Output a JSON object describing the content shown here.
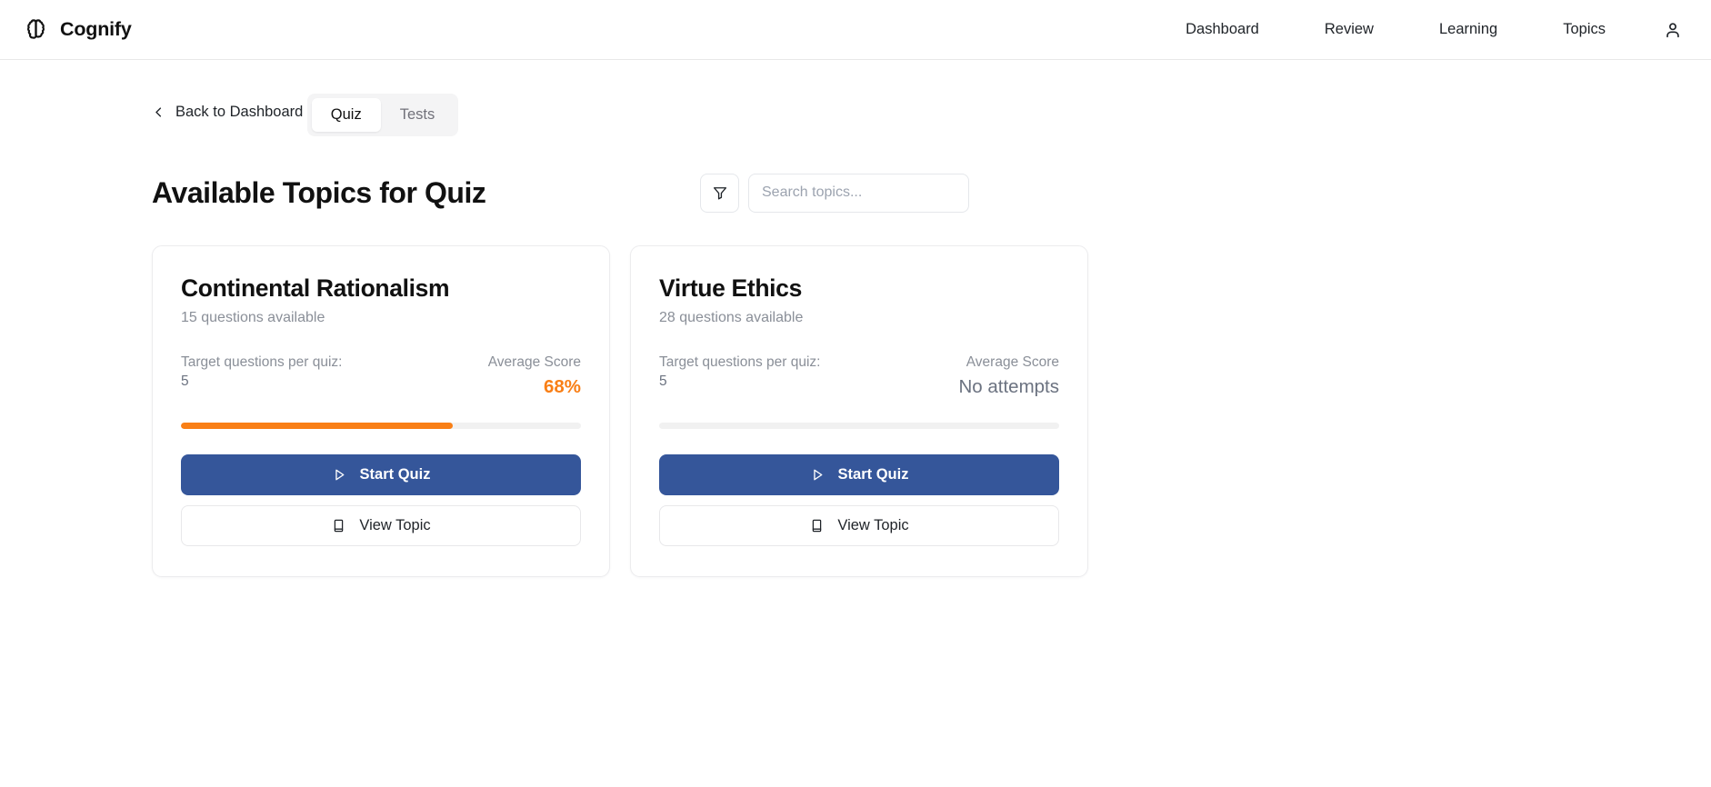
{
  "header": {
    "brand_name": "Cognify",
    "brand_icon": "brain-icon",
    "nav_items": [
      {
        "label": "Dashboard"
      },
      {
        "label": "Review"
      },
      {
        "label": "Learning"
      },
      {
        "label": "Topics"
      }
    ],
    "account_icon": "user-icon"
  },
  "back_link": {
    "label": "Back to Dashboard",
    "icon": "chevron-left-icon"
  },
  "tabs": [
    {
      "label": "Quiz",
      "active": true
    },
    {
      "label": "Tests",
      "active": false
    }
  ],
  "main": {
    "title": "Available Topics for Quiz",
    "filter_icon": "filter-icon",
    "search": {
      "placeholder": "Search topics...",
      "value": ""
    }
  },
  "colors": {
    "primary_blue": "#35569a",
    "score_orange": "#f97f16",
    "muted_text": "#8a8f98",
    "track_gray": "#f1f1f1",
    "border_gray": "#e5e7eb"
  },
  "cards": [
    {
      "title": "Continental Rationalism",
      "questions_available": "15 questions available",
      "target_label": "Target questions per quiz:",
      "target_value": "5",
      "score_label": "Average Score",
      "score_value": "68%",
      "score_percent": 68,
      "has_attempts": true,
      "start_button": {
        "label": "Start Quiz",
        "icon": "play-icon"
      },
      "view_button": {
        "label": "View Topic",
        "icon": "book-icon"
      }
    },
    {
      "title": "Virtue Ethics",
      "questions_available": "28 questions available",
      "target_label": "Target questions per quiz:",
      "target_value": "5",
      "score_label": "Average Score",
      "score_value": "No attempts",
      "score_percent": 0,
      "has_attempts": false,
      "start_button": {
        "label": "Start Quiz",
        "icon": "play-icon"
      },
      "view_button": {
        "label": "View Topic",
        "icon": "book-icon"
      }
    }
  ]
}
